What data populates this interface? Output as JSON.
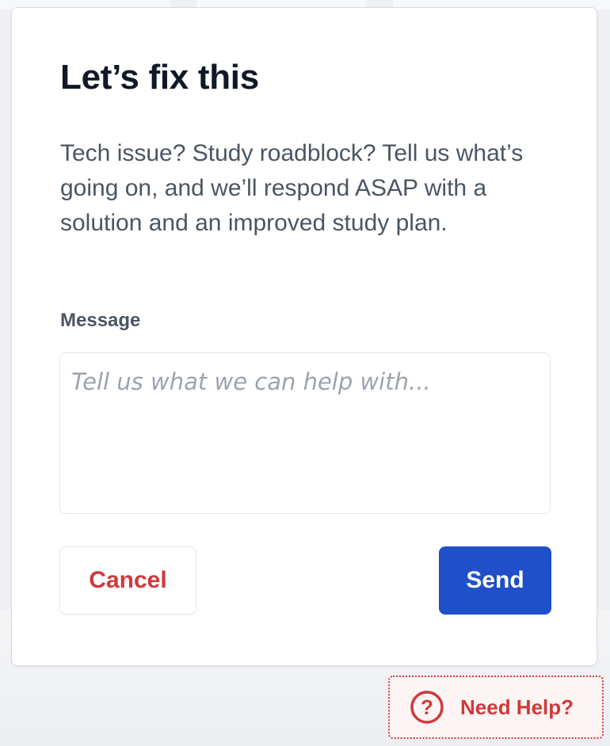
{
  "modal": {
    "title": "Let’s fix this",
    "description": "Tech issue? Study roadblock? Tell us what’s going on, and we’ll respond ASAP with a solution and an improved study plan.",
    "message_label": "Message",
    "message_placeholder": "Tell us what we can help with...",
    "message_value": "",
    "cancel_label": "Cancel",
    "send_label": "Send"
  },
  "help_widget": {
    "label": "Need Help?",
    "icon": "question-circle-icon"
  },
  "colors": {
    "primary": "#1f4fc9",
    "danger": "#d0393b",
    "title_text": "#111827",
    "body_text": "#4b5563",
    "placeholder_text": "#9ca3af"
  }
}
